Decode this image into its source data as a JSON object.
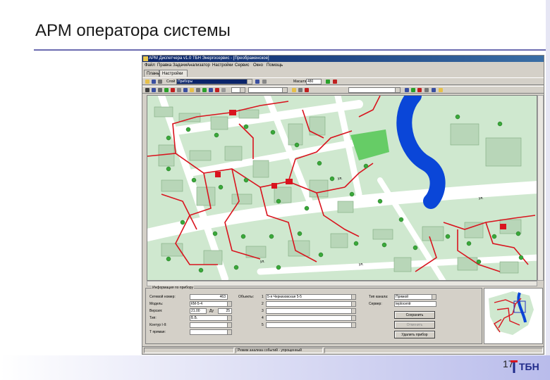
{
  "slide": {
    "title": "АРМ оператора системы",
    "page_number": "17",
    "logo_text": "ТБН"
  },
  "window": {
    "title": "АРМ Диспетчера v1.0 ТБН Энергосервис - [Преображенское]"
  },
  "menu": [
    "Файл",
    "Правка",
    "Задачи",
    "Анализатор",
    "Настройки",
    "Сервис",
    "Окно",
    "Помощь"
  ],
  "tabs": [
    "Планы",
    "Настройки"
  ],
  "toolbar": {
    "layer_label": "Слой",
    "layer_value": "Приборы",
    "zoom_label": "Масштаб",
    "zoom_value": "480"
  },
  "map": {
    "street_labels": [
      "ул.",
      "ул.",
      "ул.",
      "ул."
    ]
  },
  "form": {
    "legend": "Информация по прибору",
    "fields": [
      {
        "label": "Сетевой номер:",
        "value": "463"
      },
      {
        "label": "Модель:",
        "value": "КМ-5-4"
      },
      {
        "label": "Версия:",
        "value": "21.00"
      },
      {
        "label": "Тип:",
        "value": "Б.Б."
      },
      {
        "label": "Контур I-II:",
        "value": ""
      },
      {
        "label": "Т прямая:",
        "value": ""
      }
    ],
    "version_aux_label": "Ду",
    "version_aux_value": "25",
    "objects_label": "Объекты:",
    "objects": [
      {
        "num": "1",
        "value": "5-я Черкизовская 5-5"
      },
      {
        "num": "2",
        "value": ""
      },
      {
        "num": "3",
        "value": ""
      },
      {
        "num": "4",
        "value": ""
      },
      {
        "num": "5",
        "value": ""
      }
    ],
    "connection_label": "Тип канала:",
    "connection_value": "Прямой",
    "server_label": "Сервер:",
    "server_value": "teplocentr",
    "buttons": [
      "Сохранить",
      "Отменить",
      "Удалить прибор"
    ]
  },
  "status": {
    "message": "Режим анализа событий - упрощенный"
  },
  "colors": {
    "pipe": "#d9141e",
    "river": "#0a46d8",
    "park": "#66cc66",
    "road": "#ffffff",
    "ground": "#cfe8cf",
    "building": "#b8d6b8",
    "accent": "#6b6bb0"
  }
}
